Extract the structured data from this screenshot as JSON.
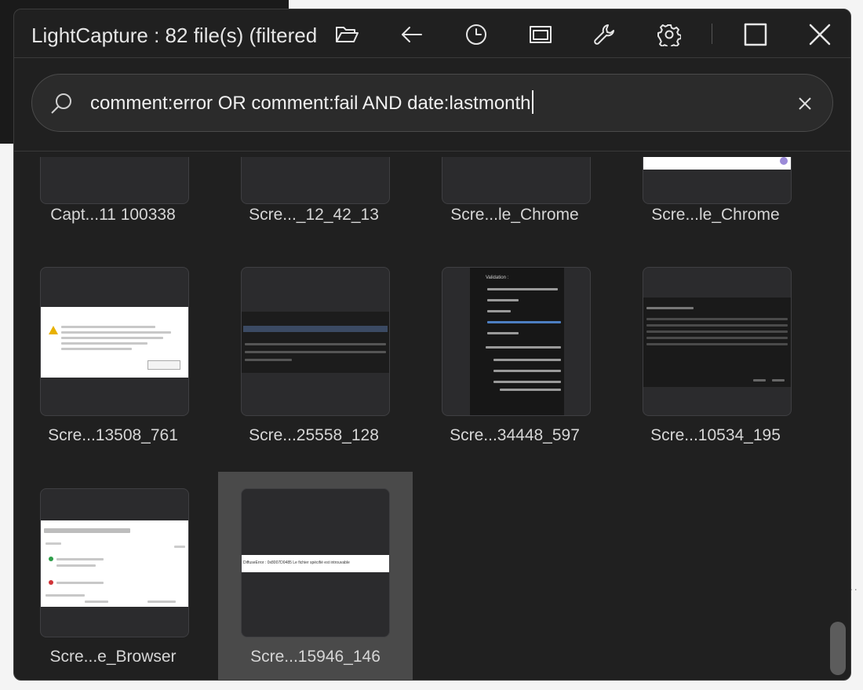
{
  "window": {
    "title": "LightCapture : 82 file(s) (filtered)"
  },
  "toolbar": {
    "icons": [
      "folder-open-icon",
      "back-arrow-icon",
      "history-icon",
      "window-icon",
      "wrench-icon",
      "gear-icon",
      "maximize-icon",
      "close-icon"
    ]
  },
  "search": {
    "query": "comment:error OR comment:fail AND date:lastmonth",
    "icon": "search-icon",
    "clear_icon": "clear-icon"
  },
  "files": [
    {
      "name": "Capt...11 100338"
    },
    {
      "name": "Scre..._12_42_13"
    },
    {
      "name": "Scre...le_Chrome"
    },
    {
      "name": "Scre...le_Chrome"
    },
    {
      "name": "Scre...13508_761"
    },
    {
      "name": "Scre...25558_128"
    },
    {
      "name": "Scre...34448_597"
    },
    {
      "name": "Scre...10534_195"
    },
    {
      "name": "Scre...e_Browser"
    },
    {
      "name": "Scre...15946_146",
      "selected": true
    }
  ],
  "thumbnail_text": {
    "validation_title": "Validation :",
    "error_banner": "DiffuseError : 0x8007D0485 Le fichier spécifié est introuvable"
  },
  "colors": {
    "window_bg": "#202020",
    "search_bg": "#2b2b2b",
    "thumb_bg": "#2b2b2d",
    "selected_bg": "#4a4a4a",
    "text": "#e6e6e6"
  }
}
